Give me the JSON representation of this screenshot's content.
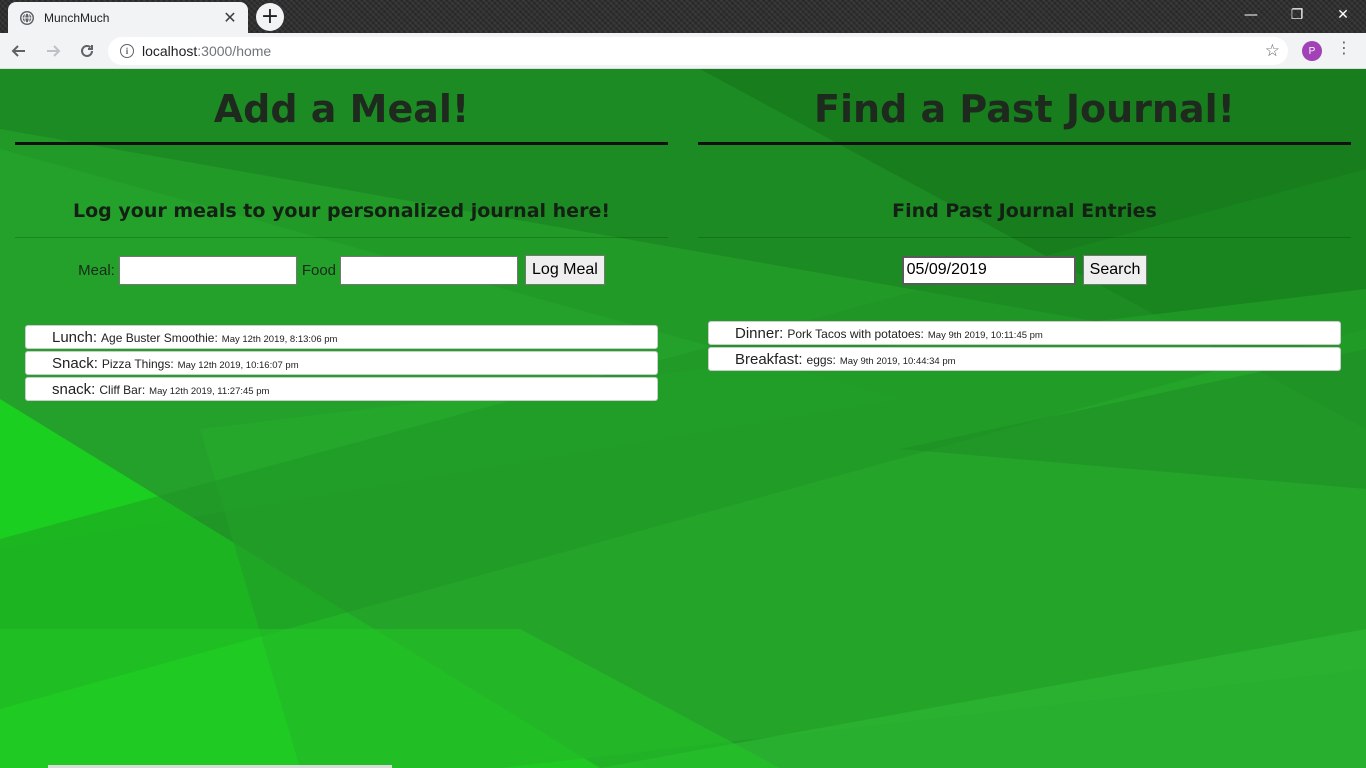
{
  "browser": {
    "tab_title": "MunchMuch",
    "tab_close": "✕",
    "new_tab": "+",
    "url_host": "localhost",
    "url_rest": ":3000/home",
    "profile_initial": "P",
    "window_controls": [
      "—",
      "❐",
      "✕"
    ]
  },
  "add_meal": {
    "title": "Add a Meal!",
    "subtitle": "Log your meals to your personalized journal here!",
    "meal_label": "Meal:",
    "meal_value": "",
    "food_label": "Food",
    "food_value": "",
    "submit_label": "Log Meal",
    "entries": [
      {
        "meal": "Lunch:",
        "food": "Age Buster Smoothie:",
        "time": "May 12th 2019, 8:13:06 pm"
      },
      {
        "meal": "Snack:",
        "food": "Pizza Things:",
        "time": "May 12th 2019, 10:16:07 pm"
      },
      {
        "meal": "snack:",
        "food": "Cliff Bar:",
        "time": "May 12th 2019, 11:27:45 pm"
      }
    ]
  },
  "find_journal": {
    "title": "Find a Past Journal!",
    "subtitle": "Find Past Journal Entries",
    "date_value": "05/09/2019",
    "search_label": "Search",
    "entries": [
      {
        "meal": "Dinner:",
        "food": "Pork Tacos with potatoes:",
        "time": "May 9th 2019, 10:11:45 pm"
      },
      {
        "meal": "Breakfast:",
        "food": "eggs:",
        "time": "May 9th 2019, 10:44:34 pm"
      }
    ]
  },
  "icons": {
    "back": "back-arrow-icon",
    "forward": "forward-arrow-icon",
    "reload": "reload-icon",
    "info": "info-icon",
    "star": "star-icon",
    "menu": "kebab-menu-icon",
    "favicon": "globe-icon"
  },
  "colors": {
    "background": "#1e8f24",
    "title_text": "#1f2a1f",
    "entry_bg": "#ffffff"
  }
}
